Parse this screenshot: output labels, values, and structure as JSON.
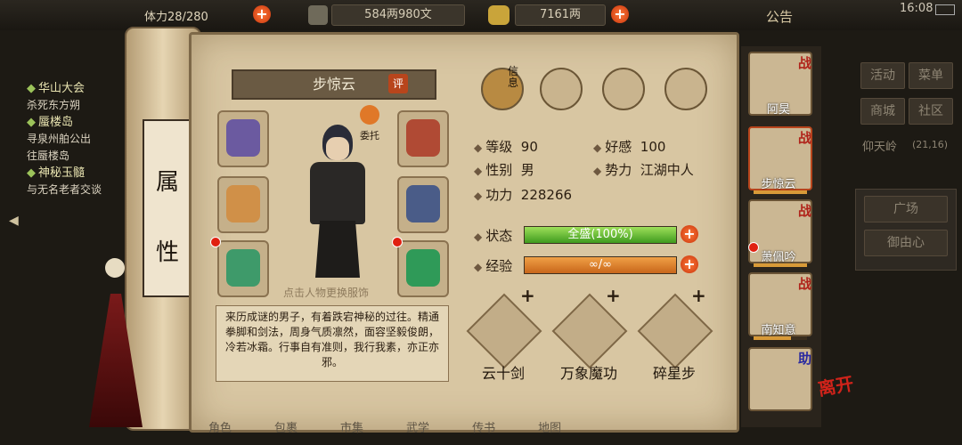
{
  "topbar": {
    "stamina": "体力",
    "stamina_value": "28/280",
    "money": "584两980文",
    "gold": "7161两",
    "announcement": "公告",
    "time": "16:08"
  },
  "quests": [
    {
      "title": "华山大会",
      "detail": [
        "杀死东方朔"
      ]
    },
    {
      "title": "蜃楼岛",
      "detail": [
        "寻泉州舶公出",
        "往蜃楼岛"
      ]
    },
    {
      "title": "神秘玉髓",
      "detail": [
        "与无名老者交谈"
      ]
    }
  ],
  "right_menu": {
    "buttons": [
      "活动",
      "菜单",
      "商城",
      "社区"
    ],
    "location": "仰天岭",
    "coords": "(21,16)",
    "small_buttons": [
      "广场",
      "御由心"
    ]
  },
  "scroll_label": [
    "属",
    "性"
  ],
  "character": {
    "name": "步惊云",
    "review_badge": "评",
    "entrust": "委托",
    "change_outfit_hint": "点击人物更换服饰",
    "level_label": "等级",
    "level": "90",
    "favor_label": "好感",
    "favor": "100",
    "gender_label": "性别",
    "gender": "男",
    "faction_label": "势力",
    "faction": "江湖中人",
    "power_label": "功力",
    "power": "228266",
    "status_label": "状态",
    "status_value": "全盛(100%)",
    "status_fill": 1.0,
    "exp_label": "经验",
    "exp_value": "∞/∞",
    "exp_fill": 1.0,
    "description": "来历成谜的男子，有着跌宕神秘的过往。精通拳脚和剑法，周身气质凛然，面容坚毅俊朗，冷若冰霜。行事自有准则，我行我素，亦正亦邪。"
  },
  "info_tabs": [
    {
      "icon": "hat-icon",
      "label": "信息"
    },
    {
      "icon": "bag-icon",
      "label": ""
    },
    {
      "icon": "bagua-icon",
      "label": ""
    },
    {
      "icon": "meridian-icon",
      "label": ""
    }
  ],
  "skills": [
    {
      "name": "云十剑",
      "plus": "+"
    },
    {
      "name": "万象魔功",
      "plus": "+"
    },
    {
      "name": "碎星步",
      "plus": "+"
    }
  ],
  "party": [
    {
      "name": "阿昊",
      "badge": "战",
      "hp": 0
    },
    {
      "name": "步惊云",
      "badge": "战",
      "hp": 1.0
    },
    {
      "name": "萧佩吟",
      "badge": "战",
      "hp": 1.0
    },
    {
      "name": "南知意",
      "badge": "战",
      "hp": 0.7
    },
    {
      "name": "",
      "badge": "助",
      "hp": 0
    }
  ],
  "leave_button": "离开",
  "bottom_bar": [
    "角色",
    "包裹",
    "市集",
    "武学",
    "传书",
    "地图"
  ]
}
